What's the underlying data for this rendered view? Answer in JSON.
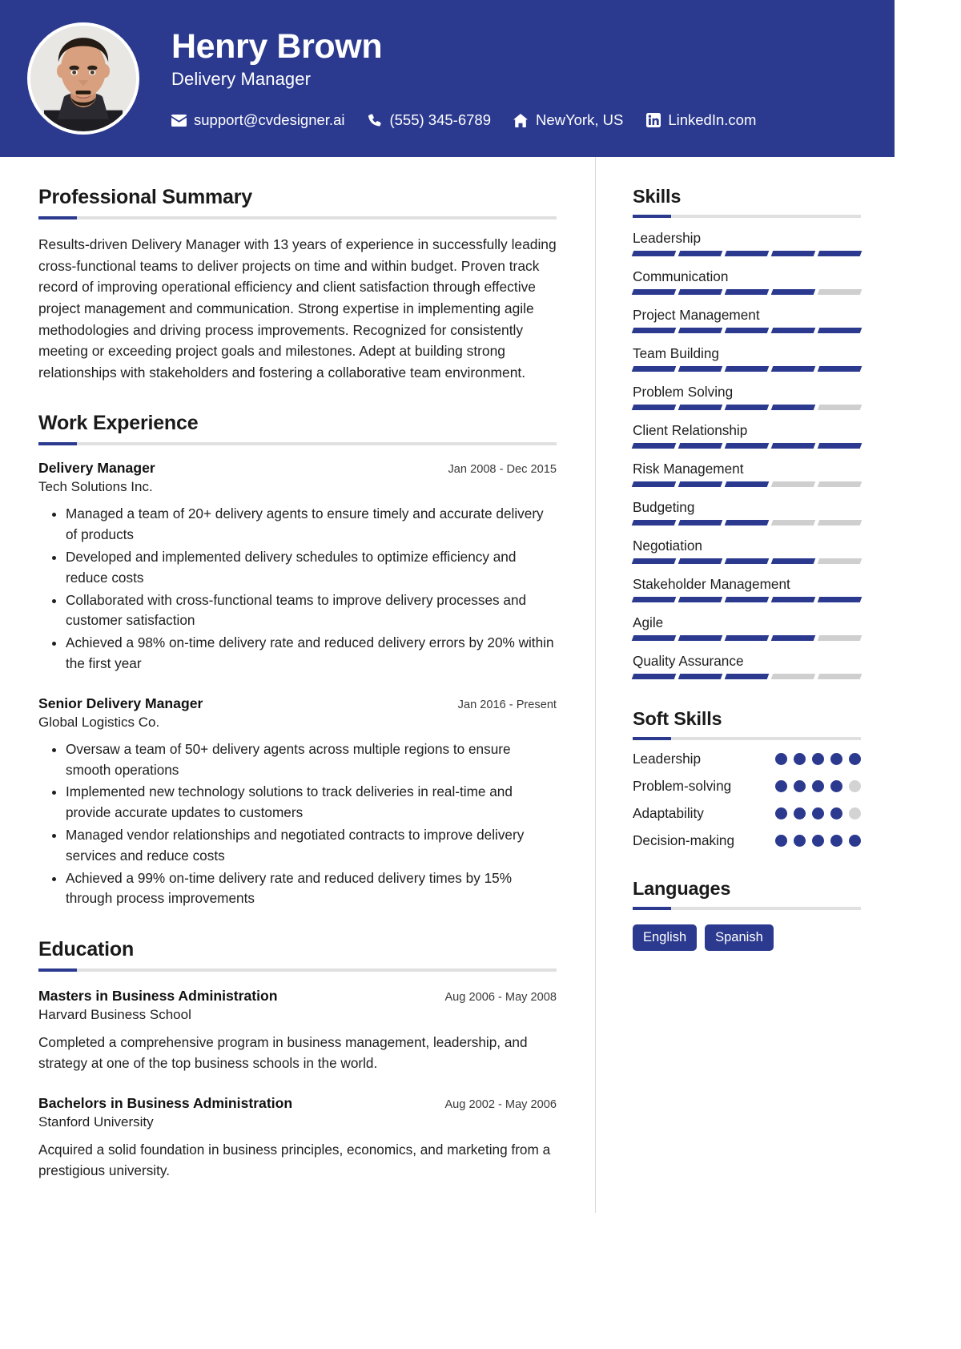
{
  "header": {
    "name": "Henry Brown",
    "role": "Delivery Manager",
    "avatar_alt": "profile-photo",
    "accent_color": "#2b3a8f",
    "contacts": [
      {
        "icon": "envelope-icon",
        "label": "support@cvdesigner.ai"
      },
      {
        "icon": "phone-icon",
        "label": "(555) 345-6789"
      },
      {
        "icon": "home-icon",
        "label": "NewYork, US"
      },
      {
        "icon": "linkedin-icon",
        "label": "LinkedIn.com"
      }
    ]
  },
  "main": {
    "summary": {
      "heading": "Professional Summary",
      "text": "Results-driven Delivery Manager with 13 years of experience in successfully leading cross-functional teams to deliver projects on time and within budget. Proven track record of improving operational efficiency and client satisfaction through effective project management and communication. Strong expertise in implementing agile methodologies and driving process improvements. Recognized for consistently meeting or exceeding project goals and milestones. Adept at building strong relationships with stakeholders and fostering a collaborative team environment."
    },
    "work": {
      "heading": "Work Experience",
      "jobs": [
        {
          "title": "Delivery Manager",
          "date": "Jan 2008 - Dec 2015",
          "company": "Tech Solutions Inc.",
          "bullets": [
            "Managed a team of 20+ delivery agents to ensure timely and accurate delivery of products",
            "Developed and implemented delivery schedules to optimize efficiency and reduce costs",
            "Collaborated with cross-functional teams to improve delivery processes and customer satisfaction",
            "Achieved a 98% on-time delivery rate and reduced delivery errors by 20% within the first year"
          ]
        },
        {
          "title": "Senior Delivery Manager",
          "date": "Jan 2016 - Present",
          "company": "Global Logistics Co.",
          "bullets": [
            "Oversaw a team of 50+ delivery agents across multiple regions to ensure smooth operations",
            "Implemented new technology solutions to track deliveries in real-time and provide accurate updates to customers",
            "Managed vendor relationships and negotiated contracts to improve delivery services and reduce costs",
            "Achieved a 99% on-time delivery rate and reduced delivery times by 15% through process improvements"
          ]
        }
      ]
    },
    "education": {
      "heading": "Education",
      "items": [
        {
          "degree": "Masters in Business Administration",
          "date": "Aug 2006 - May 2008",
          "school": "Harvard Business School",
          "description": "Completed a comprehensive program in business management, leadership, and strategy at one of the top business schools in the world."
        },
        {
          "degree": "Bachelors in Business Administration",
          "date": "Aug 2002 - May 2006",
          "school": "Stanford University",
          "description": "Acquired a solid foundation in business principles, economics, and marketing from a prestigious university."
        }
      ]
    }
  },
  "aside": {
    "skills": {
      "heading": "Skills",
      "max": 5,
      "items": [
        {
          "name": "Leadership",
          "level": 5
        },
        {
          "name": "Communication",
          "level": 4
        },
        {
          "name": "Project Management",
          "level": 5
        },
        {
          "name": "Team Building",
          "level": 5
        },
        {
          "name": "Problem Solving",
          "level": 4
        },
        {
          "name": "Client Relationship",
          "level": 5
        },
        {
          "name": "Risk Management",
          "level": 3
        },
        {
          "name": "Budgeting",
          "level": 3
        },
        {
          "name": "Negotiation",
          "level": 4
        },
        {
          "name": "Stakeholder Management",
          "level": 5
        },
        {
          "name": "Agile",
          "level": 4
        },
        {
          "name": "Quality Assurance",
          "level": 3
        }
      ]
    },
    "soft_skills": {
      "heading": "Soft Skills",
      "max": 5,
      "items": [
        {
          "name": "Leadership",
          "level": 5
        },
        {
          "name": "Problem-solving",
          "level": 4
        },
        {
          "name": "Adaptability",
          "level": 4
        },
        {
          "name": "Decision-making",
          "level": 5
        }
      ]
    },
    "languages": {
      "heading": "Languages",
      "items": [
        "English",
        "Spanish"
      ]
    }
  }
}
